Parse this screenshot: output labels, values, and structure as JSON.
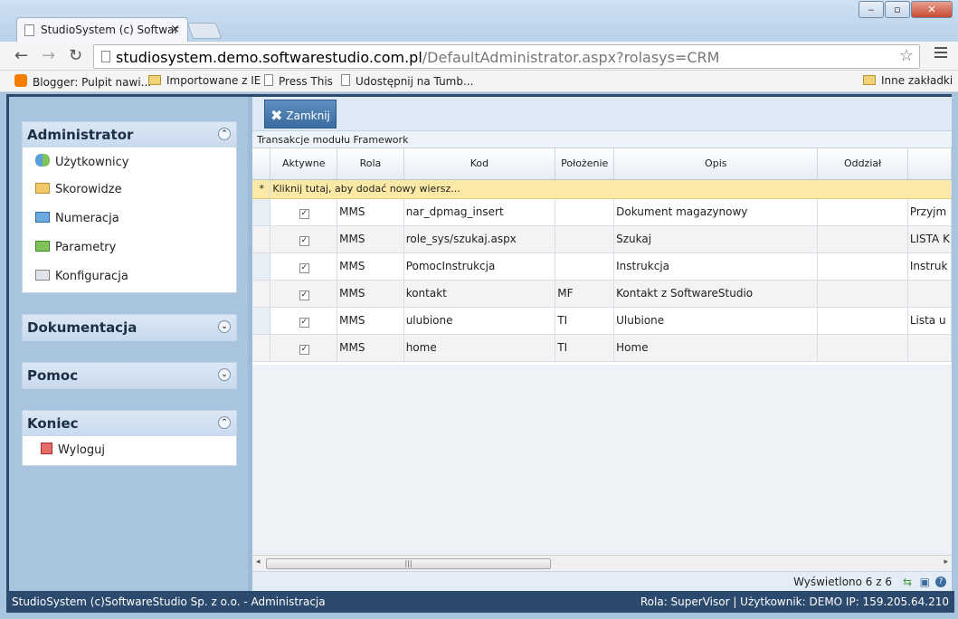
{
  "browser": {
    "tab_title": "StudioSystem (c) Softwar",
    "tab_close": "×",
    "url_host": "studiosystem.demo.softwarestudio.com.pl",
    "url_path": "/DefaultAdministrator.aspx?rolasys=CRM",
    "bookmarks": [
      "Blogger: Pulpit nawi...",
      "Importowane z IE",
      "Press This",
      "Udostępnij na Tumb...",
      "Inne zakładki"
    ]
  },
  "sidebar": {
    "administrator": {
      "title": "Administrator",
      "items": [
        "Użytkownicy",
        "Skorowidze",
        "Numeracja",
        "Parametry",
        "Konfiguracja"
      ]
    },
    "dokumentacja": {
      "title": "Dokumentacja"
    },
    "pomoc": {
      "title": "Pomoc"
    },
    "koniec": {
      "title": "Koniec",
      "items": [
        "Wyloguj"
      ]
    }
  },
  "toolbar": {
    "close_label": "Zamknij"
  },
  "grid": {
    "title": "Transakcje modułu Framework",
    "columns": [
      "Aktywne",
      "Rola",
      "Kod",
      "Położenie",
      "Opis",
      "Oddział",
      ""
    ],
    "add_row_text": "Kliknij tutaj, aby dodać nowy wiersz...",
    "rows": [
      {
        "aktywne": "✓",
        "rola": "MMS",
        "kod": "nar_dpmag_insert",
        "polozenie": "",
        "opis": "Dokument magazynowy",
        "oddzial": "",
        "extra": "Przyjm"
      },
      {
        "aktywne": "✓",
        "rola": "MMS",
        "kod": "role_sys/szukaj.aspx",
        "polozenie": "",
        "opis": "Szukaj",
        "oddzial": "",
        "extra": "LISTA K"
      },
      {
        "aktywne": "✓",
        "rola": "MMS",
        "kod": "PomocInstrukcja",
        "polozenie": "",
        "opis": "Instrukcja",
        "oddzial": "",
        "extra": "Instruk"
      },
      {
        "aktywne": "✓",
        "rola": "MMS",
        "kod": "kontakt",
        "polozenie": "MF",
        "opis": "Kontakt z SoftwareStudio",
        "oddzial": "",
        "extra": ""
      },
      {
        "aktywne": "✓",
        "rola": "MMS",
        "kod": "ulubione",
        "polozenie": "TI",
        "opis": "Ulubione",
        "oddzial": "",
        "extra": "Lista u"
      },
      {
        "aktywne": "✓",
        "rola": "MMS",
        "kod": "home",
        "polozenie": "TI",
        "opis": "Home",
        "oddzial": "",
        "extra": ""
      }
    ],
    "pager_text": "Wyświetlono 6 z 6"
  },
  "statusbar": {
    "left": "StudioSystem (c)SoftwareStudio Sp. z o.o. - Administracja",
    "right": "Rola: SuperVisor | Użytkownik: DEMO IP: 159.205.64.210"
  }
}
